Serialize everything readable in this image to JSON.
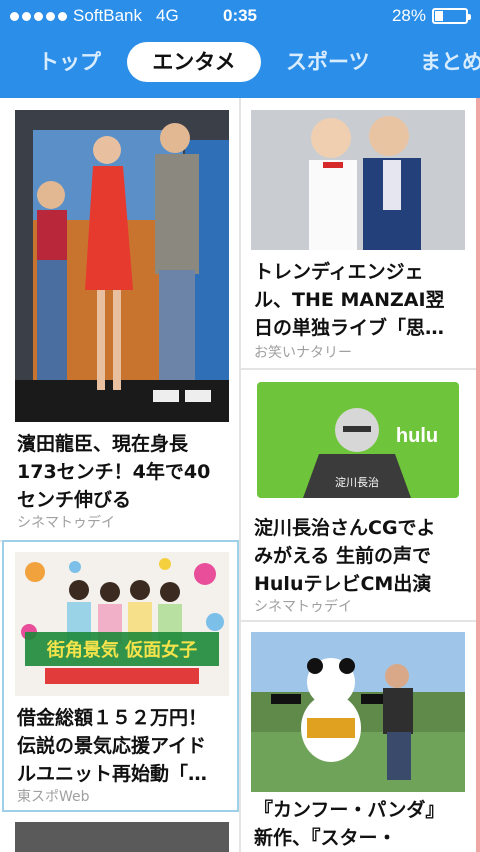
{
  "status_bar": {
    "carrier": "SoftBank",
    "network": "4G",
    "time": "0:35",
    "battery_percent_label": "28%",
    "battery_level": 0.28
  },
  "tabs": [
    {
      "label": "トップ",
      "selected": false
    },
    {
      "label": "エンタメ",
      "selected": true
    },
    {
      "label": "スポーツ",
      "selected": false
    },
    {
      "label": "まとめ",
      "selected": false
    }
  ],
  "articles": [
    {
      "title_lines": [
        "濱田龍臣、現在身長",
        "173センチ！4年で40",
        "センチ伸びる"
      ],
      "source": "シネマトゥデイ",
      "image_icon": "movie-event-photo-icon"
    },
    {
      "title_lines": [
        "トレンディエンジェ",
        "ル、THE MANZAI翌",
        "日の単独ライブ「思…"
      ],
      "source": "お笑いナタリー",
      "image_icon": "comedians-photo-icon"
    },
    {
      "title_lines": [
        "淀川長治さんCGでよ",
        "みがえる 生前の声で",
        "HuluテレビCM出演"
      ],
      "source": "シネマトゥデイ",
      "image_icon": "hulu-ad-icon",
      "image_text": {
        "brand": "hulu",
        "caption": "淀川長治"
      }
    },
    {
      "title_lines": [
        "借金総額１５２万円！",
        "伝説の景気応援アイド",
        "ルユニット再始動「…"
      ],
      "source": "東スポWeb",
      "image_icon": "idol-group-photo-icon",
      "image_text": {
        "banner": "街角景気 仮面女子"
      }
    },
    {
      "title_lines": [
        "『カンフー・パンダ』",
        "新作、『スター・"
      ],
      "source": "",
      "image_icon": "panda-photo-icon"
    }
  ],
  "colors": {
    "header_blue": "#2b8ee8",
    "tab_inactive": "#d8ecff",
    "source_gray": "#a0a0a0",
    "hulu_green": "#6ec43a"
  }
}
